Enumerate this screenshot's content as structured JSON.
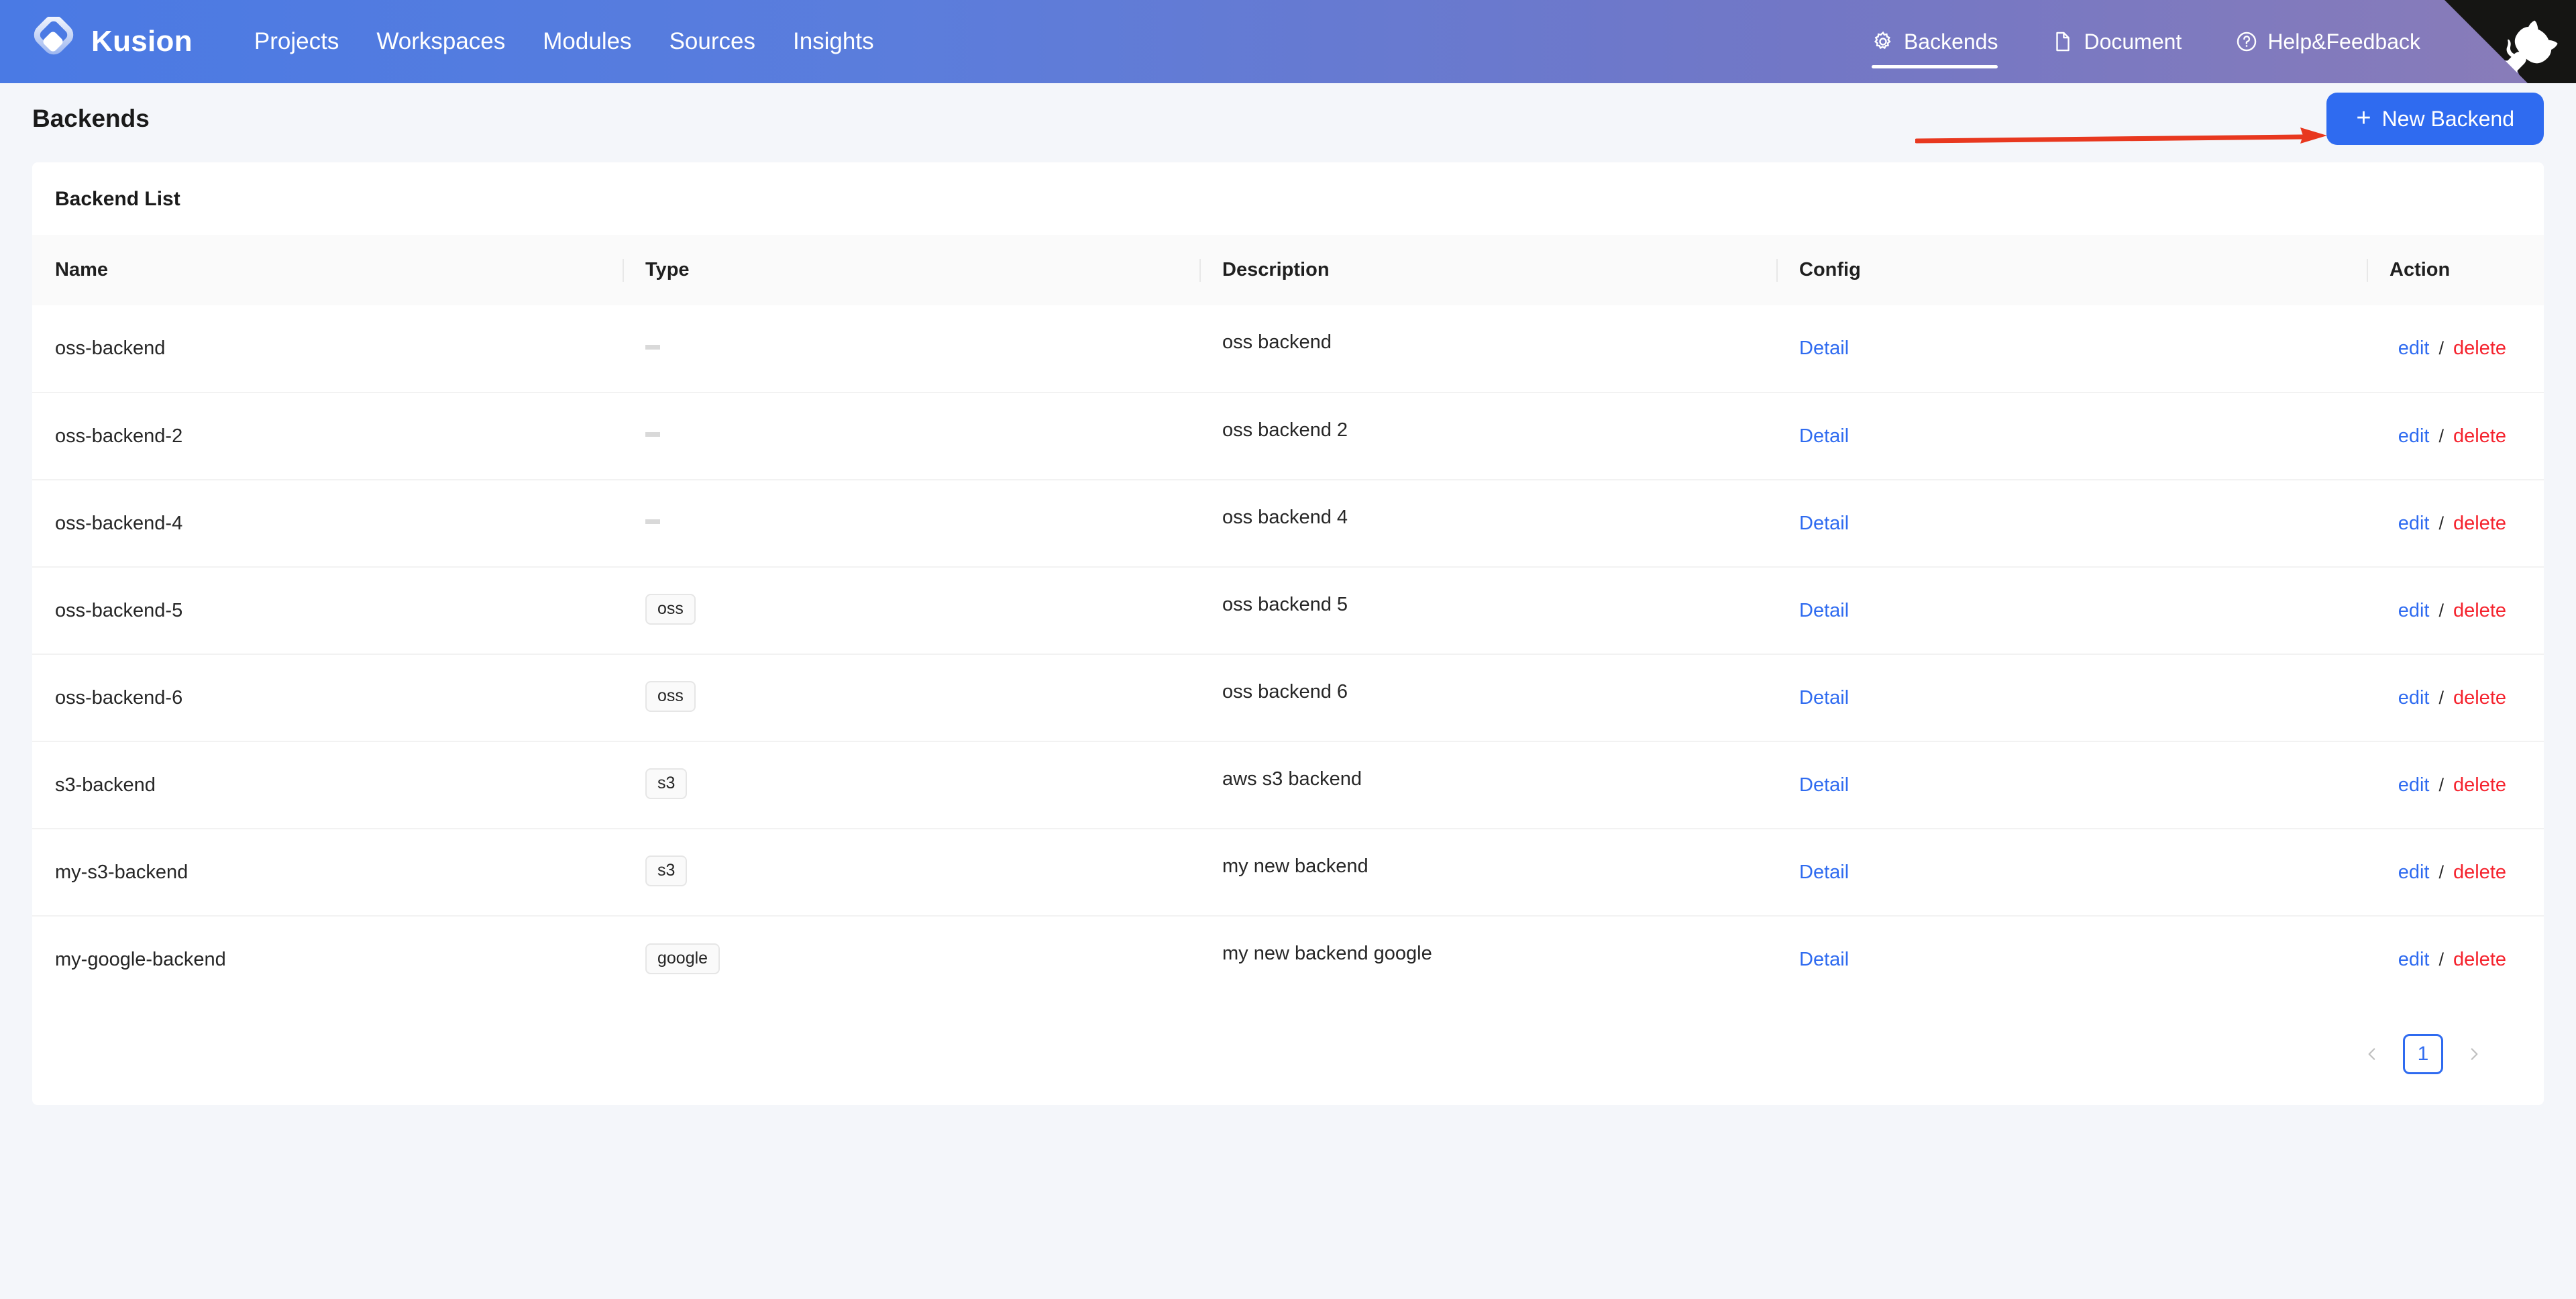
{
  "brand": {
    "name": "Kusion",
    "logo_icon": "kusion-diamond-logo"
  },
  "nav": {
    "primary": [
      {
        "label": "Projects"
      },
      {
        "label": "Workspaces"
      },
      {
        "label": "Modules"
      },
      {
        "label": "Sources"
      },
      {
        "label": "Insights"
      }
    ],
    "secondary": [
      {
        "label": "Backends",
        "icon": "gear-icon",
        "active": true
      },
      {
        "label": "Document",
        "icon": "file-icon",
        "active": false
      },
      {
        "label": "Help&Feedback",
        "icon": "question-circle-icon",
        "active": false
      }
    ],
    "corner_ribbon_icon": "github-octocat-icon"
  },
  "header": {
    "title": "Backends",
    "new_backend_label": "New Backend",
    "new_backend_plus": "+",
    "annotation": "red-arrow-pointing-to-new-backend-button"
  },
  "card": {
    "title": "Backend List"
  },
  "table": {
    "columns": [
      "Name",
      "Type",
      "Description",
      "Config",
      "Action"
    ],
    "rows": [
      {
        "name": "oss-backend",
        "type": "",
        "description": "oss backend",
        "config": "Detail",
        "edit": "edit",
        "delete": "delete"
      },
      {
        "name": "oss-backend-2",
        "type": "",
        "description": "oss backend 2",
        "config": "Detail",
        "edit": "edit",
        "delete": "delete"
      },
      {
        "name": "oss-backend-4",
        "type": "",
        "description": "oss backend 4",
        "config": "Detail",
        "edit": "edit",
        "delete": "delete"
      },
      {
        "name": "oss-backend-5",
        "type": "oss",
        "description": "oss backend 5",
        "config": "Detail",
        "edit": "edit",
        "delete": "delete"
      },
      {
        "name": "oss-backend-6",
        "type": "oss",
        "description": "oss backend 6",
        "config": "Detail",
        "edit": "edit",
        "delete": "delete"
      },
      {
        "name": "s3-backend",
        "type": "s3",
        "description": "aws s3 backend",
        "config": "Detail",
        "edit": "edit",
        "delete": "delete"
      },
      {
        "name": "my-s3-backend",
        "type": "s3",
        "description": "my new backend",
        "config": "Detail",
        "edit": "edit",
        "delete": "delete"
      },
      {
        "name": "my-google-backend",
        "type": "google",
        "description": "my new backend google",
        "config": "Detail",
        "edit": "edit",
        "delete": "delete"
      }
    ],
    "action_separator": "/"
  },
  "pagination": {
    "prev_icon": "chevron-left-icon",
    "next_icon": "chevron-right-icon",
    "current_page": "1"
  },
  "colors": {
    "nav_gradient_start": "#4a7ae4",
    "nav_gradient_end": "#8a7cb8",
    "primary_blue": "#2f6bf0",
    "danger_red": "#f5222d",
    "annotation_red": "#e8381f",
    "page_background": "#f4f6fa",
    "card_background": "#ffffff",
    "table_head_background": "#fafafa"
  }
}
